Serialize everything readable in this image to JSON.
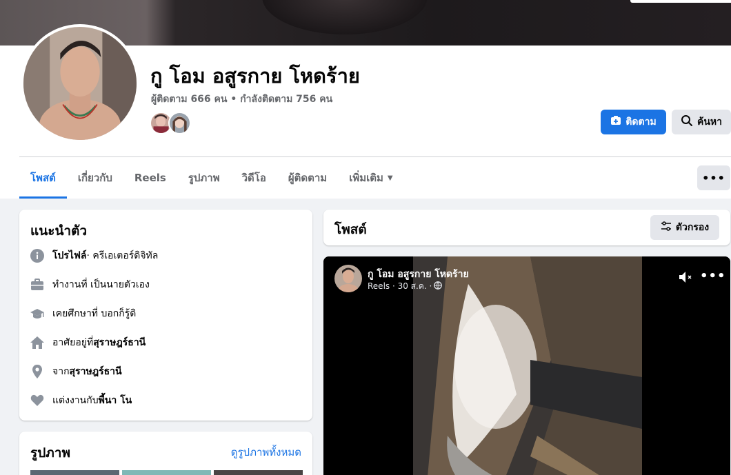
{
  "profile": {
    "name": "กู โอม อสูรกาย โหดร้าย",
    "followers_text": "ผู้ติดตาม 666 คน",
    "separator": " • ",
    "following_text": "กำลังติดตาม 756 คน"
  },
  "buttons": {
    "follow": "ติดตาม",
    "search": "ค้นหา",
    "more": "•••",
    "filter": "ตัวกรอง"
  },
  "tabs": [
    "โพสต์",
    "เกี่ยวกับ",
    "Reels",
    "รูปภาพ",
    "วิดีโอ",
    "ผู้ติดตาม",
    "เพิ่มเติม"
  ],
  "intro": {
    "title": "แนะนำตัว",
    "profile_label": "โปรไฟล์",
    "profile_value": " · ครีเอเตอร์ดิจิทัล",
    "work": "ทำงานที่ เป็นนายตัวเอง",
    "education": "เคยศึกษาที่ บอกก็รู้ดิ",
    "lives_prefix": "อาศัยอยู่ที่ ",
    "lives_value": "สุราษฎร์ธานี",
    "from_prefix": "จาก ",
    "from_value": "สุราษฎร์ธานี",
    "married_prefix": "แต่งงานกับ ",
    "married_value": "พี้นา โน"
  },
  "photos": {
    "title": "รูปภาพ",
    "see_all": "ดูรูปภาพทั้งหมด"
  },
  "posts": {
    "title": "โพสต์",
    "author": "กู โอม อสูรกาย โหดร้าย",
    "meta": "Reels · 30 ส.ค. · "
  },
  "colors": {
    "accent": "#1b74e4",
    "secondary_button": "#e4e6eb",
    "page_bg": "#f0f2f5"
  },
  "icons": [
    "info-icon",
    "briefcase-icon",
    "graduation-cap-icon",
    "home-icon",
    "location-pin-icon",
    "heart-icon",
    "search-icon",
    "follow-icon",
    "filter-icon",
    "globe-icon",
    "mute-icon"
  ]
}
